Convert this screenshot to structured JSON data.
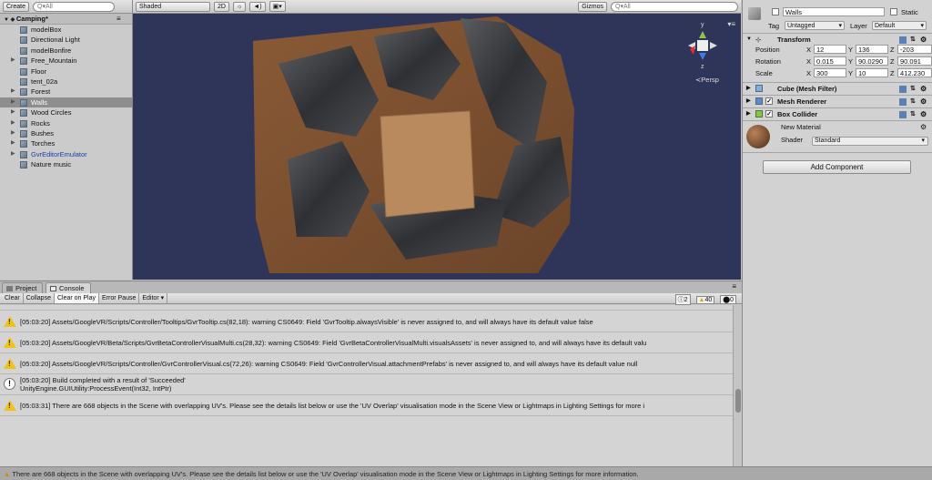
{
  "hierarchy": {
    "create_label": "Create",
    "search_placeholder": "Q▾All",
    "scene_name": "Camping*",
    "items": [
      {
        "label": "modelBox",
        "expand": false
      },
      {
        "label": "Directional Light",
        "expand": false
      },
      {
        "label": "modelBonfire",
        "expand": false
      },
      {
        "label": "Free_Mountain",
        "expand": true
      },
      {
        "label": "Floor",
        "expand": false
      },
      {
        "label": "tent_02a",
        "expand": false
      },
      {
        "label": "Forest",
        "expand": true
      },
      {
        "label": "Walls",
        "expand": true,
        "selected": true
      },
      {
        "label": "Wood Circles",
        "expand": true
      },
      {
        "label": "Rocks",
        "expand": true
      },
      {
        "label": "Bushes",
        "expand": true
      },
      {
        "label": "Torches",
        "expand": true
      },
      {
        "label": "GvrEditorEmulator",
        "expand": true,
        "blue": true
      },
      {
        "label": "Nature music",
        "expand": false
      }
    ]
  },
  "scene": {
    "shading": "Shaded",
    "mode_2d": "2D",
    "gizmos": "Gizmos",
    "search_placeholder": "Q▾All",
    "persp_label": "Persp",
    "axis_y": "y",
    "axis_z": "z"
  },
  "inspector": {
    "object_name": "Walls",
    "static_label": "Static",
    "tag_label": "Tag",
    "tag_value": "Untagged",
    "layer_label": "Layer",
    "layer_value": "Default",
    "transform_title": "Transform",
    "position_label": "Position",
    "rotation_label": "Rotation",
    "scale_label": "Scale",
    "x": "X",
    "y": "Y",
    "z": "Z",
    "position": {
      "x": "12",
      "y": "136",
      "z": "-203"
    },
    "rotation": {
      "x": "0.015",
      "y": "90.0290",
      "z": "90.091"
    },
    "scale": {
      "x": "300",
      "y": "10",
      "z": "412.230"
    },
    "mesh_filter": "Cube (Mesh Filter)",
    "mesh_renderer": "Mesh Renderer",
    "box_collider": "Box Collider",
    "material_name": "New Material",
    "shader_label": "Shader",
    "shader_value": "Standard",
    "add_component": "Add Component"
  },
  "console": {
    "tab_project": "Project",
    "tab_console": "Console",
    "buttons": [
      "Clear",
      "Collapse",
      "Clear on Play",
      "Error Pause",
      "Editor ▾"
    ],
    "count_info": "2",
    "count_warn": "40",
    "count_error": "0",
    "messages": [
      {
        "type": "warn",
        "text": "[05:03:20] Assets/GoogleVR/Scripts/Controller/Tooltips/GvrTooltip.cs(82,18): warning CS0649: Field 'GvrTooltip.alwaysVisible' is never assigned to, and will always have its default value false"
      },
      {
        "type": "warn",
        "text": "[05:03:20] Assets/GoogleVR/Beta/Scripts/GvrBetaControllerVisualMulti.cs(28,32): warning CS0649: Field 'GvrBetaControllerVisualMulti.visualsAssets' is never assigned to, and will always have its default valu"
      },
      {
        "type": "warn",
        "text": "[05:03:20] Assets/GoogleVR/Scripts/Controller/GvrControllerVisual.cs(72,26): warning CS0649: Field 'GvrControllerVisual.attachmentPrefabs' is never assigned to, and will always have its default value null"
      },
      {
        "type": "info",
        "line1": "[05:03:20] Build completed with a result of 'Succeeded'",
        "line2": "UnityEngine.GUIUtility:ProcessEvent(Int32, IntPtr)"
      },
      {
        "type": "warn",
        "text": "[05:03:31] There are 668 objects in the Scene with overlapping UV's. Please see the details list below or use the 'UV Overlap' visualisation mode in the Scene View or Lightmaps in Lighting Settings for more i"
      }
    ]
  },
  "status_bar": "There are 668 objects in the Scene with overlapping UV's. Please see the details list below or use the 'UV Overlap' visualisation mode in the Scene View or Lightmaps in Lighting Settings for more information."
}
